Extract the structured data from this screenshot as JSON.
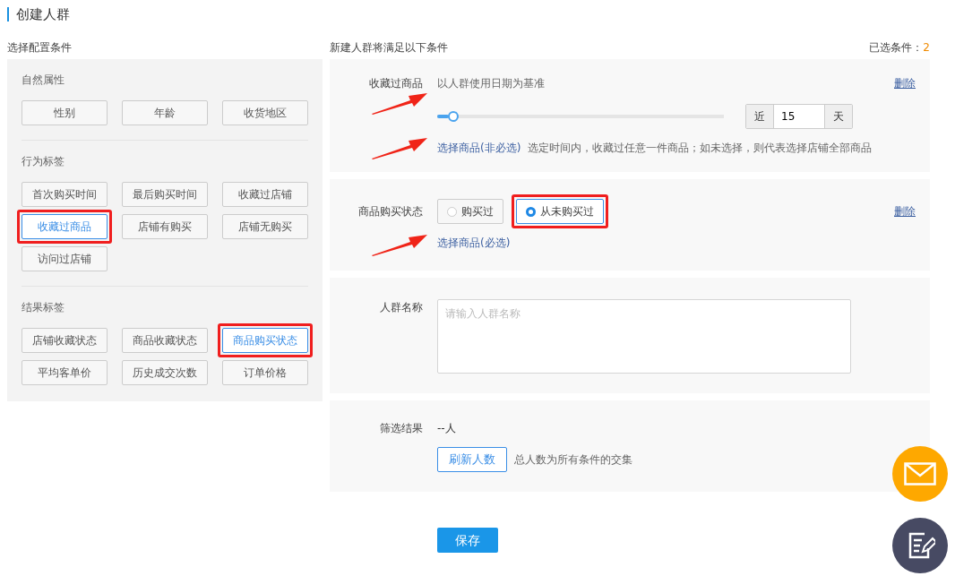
{
  "page_title": "创建人群",
  "left": {
    "heading": "选择配置条件",
    "groups": [
      {
        "title": "自然属性",
        "options": [
          {
            "label": "性别",
            "selected": false,
            "highlighted": false
          },
          {
            "label": "年龄",
            "selected": false,
            "highlighted": false
          },
          {
            "label": "收货地区",
            "selected": false,
            "highlighted": false
          }
        ]
      },
      {
        "title": "行为标签",
        "options": [
          {
            "label": "首次购买时间",
            "selected": false,
            "highlighted": false
          },
          {
            "label": "最后购买时间",
            "selected": false,
            "highlighted": false
          },
          {
            "label": "收藏过店铺",
            "selected": false,
            "highlighted": false
          },
          {
            "label": "收藏过商品",
            "selected": true,
            "highlighted": true
          },
          {
            "label": "店铺有购买",
            "selected": false,
            "highlighted": false
          },
          {
            "label": "店铺无购买",
            "selected": false,
            "highlighted": false
          },
          {
            "label": "访问过店铺",
            "selected": false,
            "highlighted": false
          }
        ]
      },
      {
        "title": "结果标签",
        "options": [
          {
            "label": "店铺收藏状态",
            "selected": false,
            "highlighted": false
          },
          {
            "label": "商品收藏状态",
            "selected": false,
            "highlighted": false
          },
          {
            "label": "商品购买状态",
            "selected": true,
            "highlighted": true
          },
          {
            "label": "平均客单价",
            "selected": false,
            "highlighted": false
          },
          {
            "label": "历史成交次数",
            "selected": false,
            "highlighted": false
          },
          {
            "label": "订单价格",
            "selected": false,
            "highlighted": false
          }
        ]
      }
    ]
  },
  "right": {
    "heading": "新建人群将满足以下条件",
    "selected_count_label": "已选条件：",
    "selected_count": "2",
    "conditions": [
      {
        "kind": "slider",
        "label": "收藏过商品",
        "hint": "以人群使用日期为基准",
        "delete": "删除",
        "level": 0.04,
        "prefix": "近",
        "value": "15",
        "suffix": "天",
        "link": "选择商品(非必选)",
        "note": "选定时间内，收藏过任意一件商品；如未选择，则代表选择店铺全部商品"
      },
      {
        "kind": "radio",
        "label": "商品购买状态",
        "delete": "删除",
        "options": [
          {
            "label": "购买过",
            "selected": false,
            "highlighted": false
          },
          {
            "label": "从未购买过",
            "selected": true,
            "highlighted": true
          }
        ],
        "link": "选择商品(必选)"
      }
    ],
    "name_field": {
      "label": "人群名称",
      "placeholder": "请输入人群名称"
    },
    "result": {
      "label": "筛选结果",
      "value": "--人",
      "button": "刷新人数",
      "note": "总人数为所有条件的交集"
    },
    "save": "保存"
  }
}
